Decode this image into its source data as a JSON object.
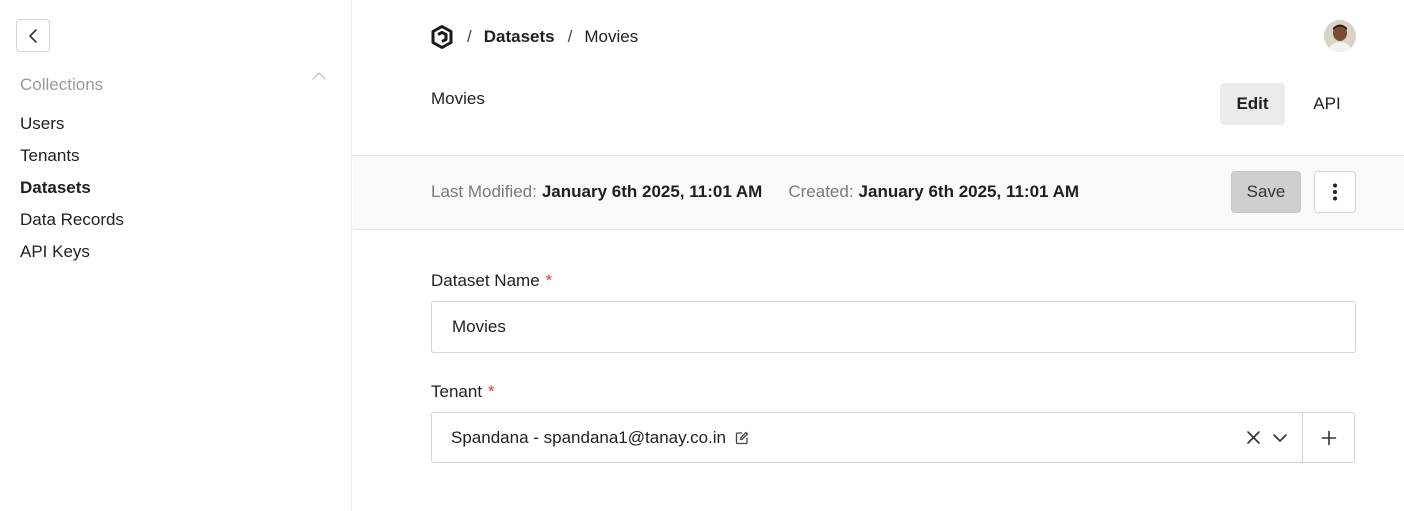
{
  "sidebar": {
    "section_title": "Collections",
    "items": [
      {
        "label": "Users",
        "active": false
      },
      {
        "label": "Tenants",
        "active": false
      },
      {
        "label": "Datasets",
        "active": true
      },
      {
        "label": "Data Records",
        "active": false
      },
      {
        "label": "API Keys",
        "active": false
      }
    ]
  },
  "header": {
    "breadcrumb": {
      "separator": "/",
      "parent": "Datasets",
      "current": "Movies"
    },
    "logo_icon": "hexagon-logo-icon",
    "avatar_icon": "user-avatar"
  },
  "page": {
    "title": "Movies",
    "edit_label": "Edit",
    "api_label": "API"
  },
  "meta": {
    "modified_label": "Last Modified:",
    "modified_value": "January 6th 2025, 11:01 AM",
    "created_label": "Created:",
    "created_value": "January 6th 2025, 11:01 AM",
    "save_label": "Save"
  },
  "form": {
    "dataset_name": {
      "label": "Dataset Name",
      "required_mark": "*",
      "value": "Movies"
    },
    "tenant": {
      "label": "Tenant",
      "required_mark": "*",
      "value": "Spandana - spandana1@tanay.co.in"
    }
  },
  "colors": {
    "required": "#e03a3a",
    "save_bg": "#cfcfcf",
    "edit_bg": "#ebebeb"
  }
}
